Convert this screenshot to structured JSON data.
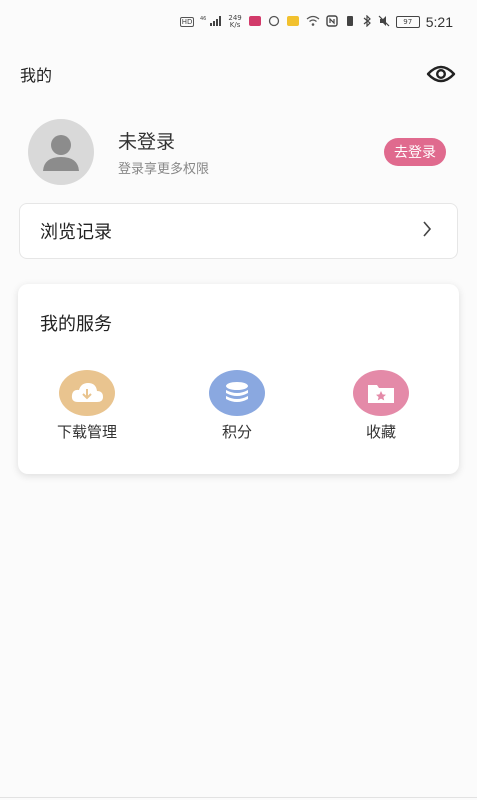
{
  "status_bar": {
    "hd_label": "HD",
    "network": "46",
    "speed_value": "249",
    "speed_unit": "K/s",
    "battery": "97",
    "time": "5:21"
  },
  "header": {
    "title": "我的",
    "eye_icon": "eye-icon"
  },
  "profile": {
    "name": "未登录",
    "subtitle": "登录享更多权限",
    "login_button": "去登录",
    "login_color": "#e06a8e"
  },
  "history": {
    "label": "浏览记录"
  },
  "services": {
    "title": "我的服务",
    "items": [
      {
        "label": "下载管理",
        "icon": "cloud-download-icon",
        "color": "#e9c48f"
      },
      {
        "label": "积分",
        "icon": "coins-stack-icon",
        "color": "#8aa8e0"
      },
      {
        "label": "收藏",
        "icon": "folder-star-icon",
        "color": "#e48aa8"
      }
    ]
  }
}
